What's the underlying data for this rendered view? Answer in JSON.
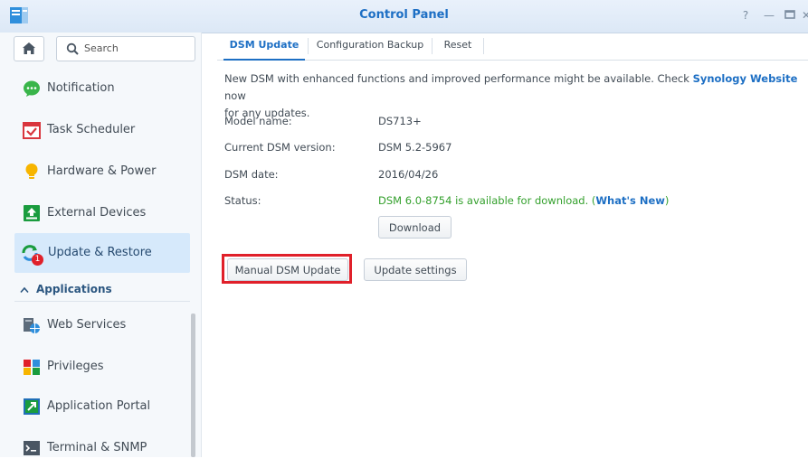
{
  "window": {
    "title": "Control Panel"
  },
  "sidebar": {
    "search_placeholder": "Search",
    "items": [
      {
        "label": "Notification"
      },
      {
        "label": "Task Scheduler"
      },
      {
        "label": "Hardware & Power"
      },
      {
        "label": "External Devices"
      },
      {
        "label": "Update & Restore",
        "badge": "1"
      }
    ],
    "section": "Applications",
    "app_items": [
      {
        "label": "Web Services"
      },
      {
        "label": "Privileges"
      },
      {
        "label": "Application Portal"
      },
      {
        "label": "Terminal & SNMP"
      }
    ]
  },
  "tabs": [
    {
      "label": "DSM Update"
    },
    {
      "label": "Configuration Backup"
    },
    {
      "label": "Reset"
    }
  ],
  "update": {
    "intro_text": "New DSM with enhanced functions and improved performance might be available. Check",
    "intro_link": "Synology Website",
    "intro_suffix": "now",
    "intro_line2": "for any updates.",
    "model_label": "Model name:",
    "model_value": "DS713+",
    "version_label": "Current DSM version:",
    "version_value": "DSM 5.2-5967",
    "date_label": "DSM date:",
    "date_value": "2016/04/26",
    "status_label": "Status:",
    "status_text": "DSM 6.0-8754 is available for download. (",
    "status_link": "What's New",
    "status_close": ")",
    "download_button": "Download",
    "manual_button": "Manual DSM Update",
    "settings_button": "Update settings"
  },
  "colors": {
    "accent": "#1d6fc4",
    "status_ok": "#33a02c",
    "highlight": "#e0202a"
  }
}
